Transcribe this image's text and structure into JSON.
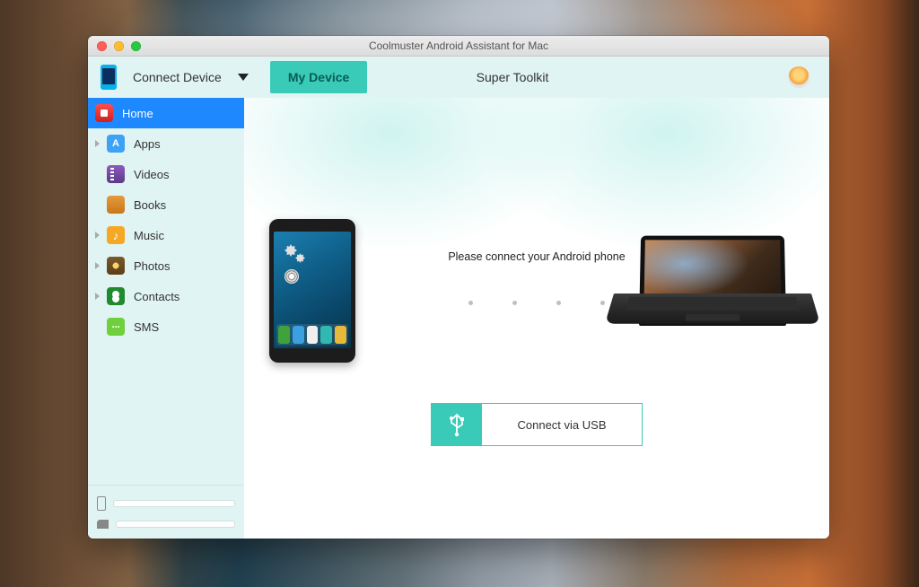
{
  "window": {
    "title": "Coolmuster Android Assistant for Mac"
  },
  "toolbar": {
    "connect_device_label": "Connect Device",
    "my_device_label": "My Device",
    "super_toolkit_label": "Super Toolkit"
  },
  "sidebar": {
    "items": [
      {
        "label": "Home",
        "icon": "home-icon",
        "has_arrow": false,
        "active": true
      },
      {
        "label": "Apps",
        "icon": "apps-icon",
        "has_arrow": true,
        "active": false
      },
      {
        "label": "Videos",
        "icon": "videos-icon",
        "has_arrow": false,
        "active": false
      },
      {
        "label": "Books",
        "icon": "books-icon",
        "has_arrow": false,
        "active": false
      },
      {
        "label": "Music",
        "icon": "music-icon",
        "has_arrow": true,
        "active": false
      },
      {
        "label": "Photos",
        "icon": "photos-icon",
        "has_arrow": true,
        "active": false
      },
      {
        "label": "Contacts",
        "icon": "contacts-icon",
        "has_arrow": true,
        "active": false
      },
      {
        "label": "SMS",
        "icon": "sms-icon",
        "has_arrow": false,
        "active": false
      }
    ]
  },
  "main": {
    "connect_prompt": "Please connect your Android phone",
    "usb_button_label": "Connect via USB"
  },
  "colors": {
    "accent_teal": "#39cbb8",
    "sidebar_bg": "#e0f4f3",
    "active_blue": "#1e88ff"
  }
}
